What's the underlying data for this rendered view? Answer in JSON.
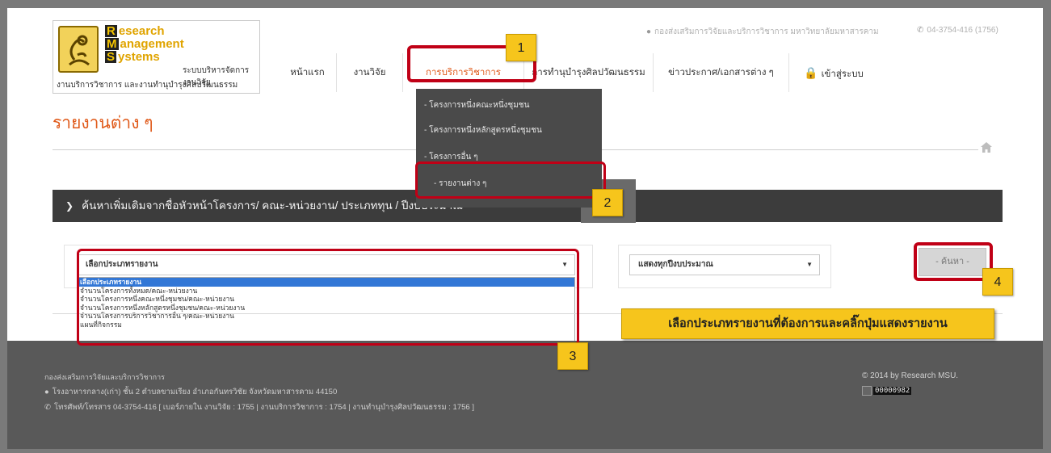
{
  "logo": {
    "line1_cap": "R",
    "line1_rest": "esearch",
    "line2_cap": "M",
    "line2_rest": "anagement",
    "line3_cap": "S",
    "line3_rest": "ystems",
    "subtitle": "ระบบบริหารจัดการงานวิจัย",
    "footer": "งานบริการวิชาการ และงานทำนุบำรุงศิลปวัฒนธรรม"
  },
  "topbar": {
    "org": "กองส่งเสริมการวิจัยและบริการวิชาการ มหาวิทยาลัยมหาสารคาม",
    "phone": "04-3754-416 (1756)"
  },
  "nav": {
    "items": [
      "หน้าแรก",
      "งานวิจัย",
      "การบริการวิชาการ",
      "การทำนุบำรุงศิลปวัฒนธรรม",
      "ข่าวประกาศ/เอกสารต่าง ๆ",
      "เข้าสู่ระบบ"
    ]
  },
  "dropdown": {
    "items": [
      "- โครงการหนึ่งคณะหนึ่งชุมชน",
      "- โครงการหนึ่งหลักสูตรหนึ่งชุมชน",
      "- โครงการอื่น ๆ",
      "- รายงานต่าง ๆ"
    ]
  },
  "page": {
    "title": "รายงานต่าง ๆ"
  },
  "searchbar": {
    "label": "ค้นหาเพิ่มเติมจากชื่อหัวหน้าโครงการ/ คณะ-หน่วยงาน/ ประเภททุน / ปีงบประมาณ"
  },
  "report_select": {
    "value": "เลือกประเภทรายงาน",
    "options": [
      "เลือกประเภทรายงาน",
      "จำนวนโครงการทั้งหมด/คณะ-หน่วยงาน",
      "จำนวนโครงการหนึ่งคณะหนึ่งชุมชน/คณะ-หน่วยงาน",
      "จำนวนโครงการหนึ่งหลักสูตรหนึ่งชุมชน/คณะ-หน่วยงาน",
      "จำนวนโครงการบริการวิชาการอื่น ๆ/คณะ-หน่วยงาน",
      "แผนที่กิจกรรม"
    ]
  },
  "year_select": {
    "value": "แสดงทุกปีงบประมาณ"
  },
  "search_button": {
    "label": "- ค้นหา -"
  },
  "annotations": {
    "badges": [
      "1",
      "2",
      "3",
      "4"
    ],
    "callout": "เลือกประเภทรายงานที่ต้องการและคลิ๊กปุ่มแสดงรายงาน",
    "color_red": "#c00016",
    "color_yellow": "#f6c51c"
  },
  "footer": {
    "org": "กองส่งเสริมการวิจัยและบริการวิชาการ",
    "address": "โรงอาหารกลาง(เก่า) ชั้น 2 ตำบลขามเรียง อำเภอกันทรวิชัย จังหวัดมหาสารคาม 44150",
    "phone": "โทรศัพท์/โทรสาร 04-3754-416 [ เบอร์ภายใน งานวิจัย : 1755 | งานบริการวิชาการ : 1754 | งานทำนุบำรุงศิลปวัฒนธรรม : 1756 ]",
    "copyright": "© 2014 by Research MSU.",
    "counter": "00000982"
  },
  "icons": {
    "location": "map-pin-icon",
    "phone": "phone-icon",
    "home": "home-icon",
    "lock": "lock-icon",
    "chevron": "chevron-down-icon"
  }
}
